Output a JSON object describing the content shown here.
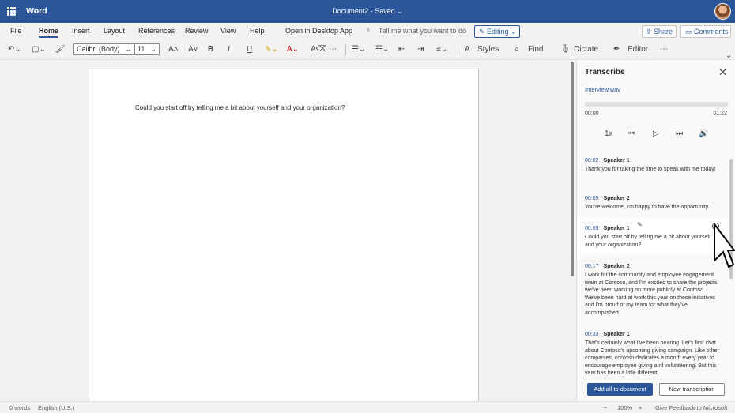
{
  "titlebar": {
    "app_name": "Word",
    "document": "Document2 - Saved ⌄"
  },
  "menu": {
    "items": [
      "File",
      "Home",
      "Insert",
      "Layout",
      "References",
      "Review",
      "View",
      "Help",
      "Open in Desktop App"
    ],
    "active": "Home",
    "tell_me": "Tell me what you want to do",
    "editing": "✎ Editing ⌄",
    "share": "⇪ Share",
    "comments": "▭ Comments"
  },
  "ribbon": {
    "font_name": "Calibri (Body)",
    "font_size": "11",
    "styles_label": "Styles",
    "find_label": "Find",
    "dictate_label": "Dictate",
    "editor_label": "Editor",
    "accent_color": "#2b579a"
  },
  "document": {
    "text": "Could you start off by telling me a bit about yourself and your organization?"
  },
  "status": {
    "words": "0 words",
    "language": "English (U.S.)",
    "zoom": "100%",
    "feedback": "Give Feedback to Microsoft"
  },
  "transcribe": {
    "title": "Transcribe",
    "file": "Interview.wav",
    "time_start": "00:00",
    "time_end": "01:22",
    "speed": "1x",
    "entries": [
      {
        "time": "00:02",
        "speaker": "Speaker 1",
        "text": "Thank you for taking the time to speak with me today!"
      },
      {
        "time": "00:05",
        "speaker": "Speaker 2",
        "text": "You're welcome, I'm happy to have the opportunity."
      },
      {
        "time": "00:09",
        "speaker": "Speaker 1",
        "text": "Could you start off by telling me a bit about yourself and your organization?"
      },
      {
        "time": "00:17",
        "speaker": "Speaker 2",
        "text": "I work for the community and employee engagement team at Contoso, and I'm excited to share the projects we've been working on more publicly at Contoso. We've been hard at work this year on these initiatives and I'm proud of my team for what they've accomplished."
      },
      {
        "time": "00:33",
        "speaker": "Speaker 1",
        "text": "That's certainly what I've been hearing. Let's first chat about Contoso's upcoming giving campaign. Like other companies, contoso dedicates a month every year to encourage employee giving and volunteering. But this year has been a little different,"
      }
    ],
    "add_all": "Add all to document",
    "new_transcription": "New transcription"
  }
}
